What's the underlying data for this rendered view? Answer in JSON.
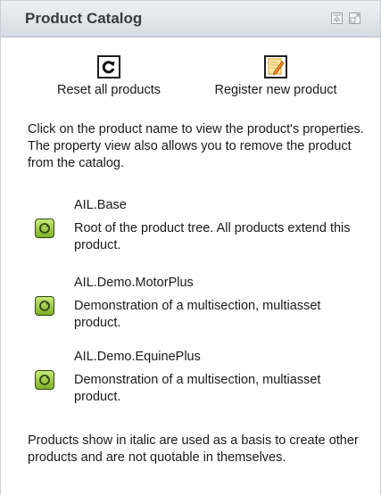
{
  "portlet": {
    "title": "Product Catalog"
  },
  "actions": {
    "reset_label": "Reset all products",
    "register_label": "Register new product"
  },
  "intro_text": "Click on the product name to view the product's properties. The property view also allows you to remove the product from the catalog.",
  "products": [
    {
      "name": "AIL.Base",
      "description": "Root of the product tree. All products extend this product."
    },
    {
      "name": "AIL.Demo.MotorPlus",
      "description": "Demonstration of a multisection, multiasset product."
    },
    {
      "name": "AIL.Demo.EquinePlus",
      "description": "Demonstration of a multisection, multiasset product."
    }
  ],
  "footer_note": "Products show in italic are used as a basis to create other products and are not quotable in themselves.",
  "icons": {
    "reset": "refresh-icon",
    "register": "edit-icon",
    "product": "product-icon",
    "header_left": "restore-window-icon",
    "header_right": "maximize-window-icon"
  },
  "colors": {
    "header_bg": "#d7dbe2",
    "product_icon_green": "#7fb027",
    "edit_icon_orange": "#f0a020"
  }
}
